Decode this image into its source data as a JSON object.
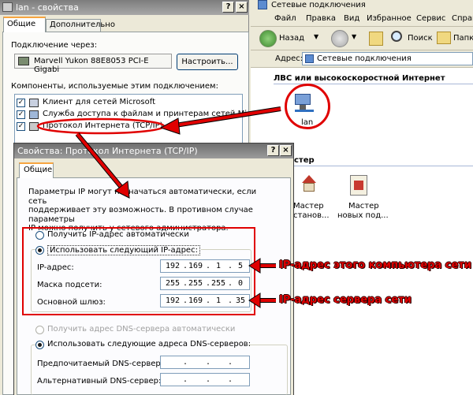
{
  "lan_dialog": {
    "title": "lan - свойства",
    "tab_general": "Общие",
    "tab_advanced": "Дополнительно",
    "connect_using_label": "Подключение через:",
    "adapter": "Marvell Yukon 88E8053 PCI-E Gigabi",
    "configure_button": "Настроить...",
    "components_label": "Компоненты, используемые этим подключением:",
    "components": [
      {
        "label": "Клиент для сетей Microsoft",
        "checked": true,
        "icon": "network-client-icon"
      },
      {
        "label": "Служба доступа к файлам и принтерам сетей Micro",
        "checked": true,
        "icon": "file-sharing-icon"
      },
      {
        "label": "Протокол Интернета (TCP/IP)",
        "checked": true,
        "icon": "protocol-icon"
      }
    ]
  },
  "explorer": {
    "title": "Сетевые подключения",
    "menu": [
      "Файл",
      "Правка",
      "Вид",
      "Избранное",
      "Сервис",
      "Справ"
    ],
    "back_label": "Назад",
    "search_label": "Поиск",
    "folders_label": "Папк",
    "address_label": "Адрес:",
    "address_value": "Сетевые подключения",
    "section_title": "ЛВС или высокоскоростной Интернет",
    "connection_label": "lan",
    "wizard_section": "стер",
    "wizards": [
      {
        "line1": "Мастер",
        "line2": "станов...",
        "icon": "home-network-wizard-icon"
      },
      {
        "line1": "Мастер",
        "line2": "новых под...",
        "icon": "new-connection-wizard-icon"
      }
    ]
  },
  "tcp_dialog": {
    "title": "Свойства: Протокол Интернета (TCP/IP)",
    "tab_general": "Общие",
    "intro": [
      "Параметры IP могут назначаться автоматически, если сеть",
      "поддерживает эту возможность. В противном случае параметры",
      "IP можно получить у сетевого администратора."
    ],
    "radio_auto_ip": "Получить IP-адрес автоматически",
    "radio_manual_ip": "Использовать следующий IP-адрес:",
    "ip_label": "IP-адрес:",
    "ip_value": [
      "192",
      "169",
      "1",
      "5"
    ],
    "mask_label": "Маска подсети:",
    "mask_value": [
      "255",
      "255",
      "255",
      "0"
    ],
    "gateway_label": "Основной шлюз:",
    "gateway_value": [
      "192",
      "169",
      "1",
      "35"
    ],
    "radio_auto_dns": "Получить адрес DNS-сервера автоматически",
    "radio_manual_dns": "Использовать следующие адреса DNS-серверов:",
    "preferred_dns_label": "Предпочитаемый DNS-сервер:",
    "alternate_dns_label": "Альтернативный DNS-сервер:"
  },
  "annotations": {
    "ip_callout": "IP-адрес этого компьютера сети",
    "gateway_callout": "IP-адрес сервера сети",
    "color": "#e00000"
  }
}
